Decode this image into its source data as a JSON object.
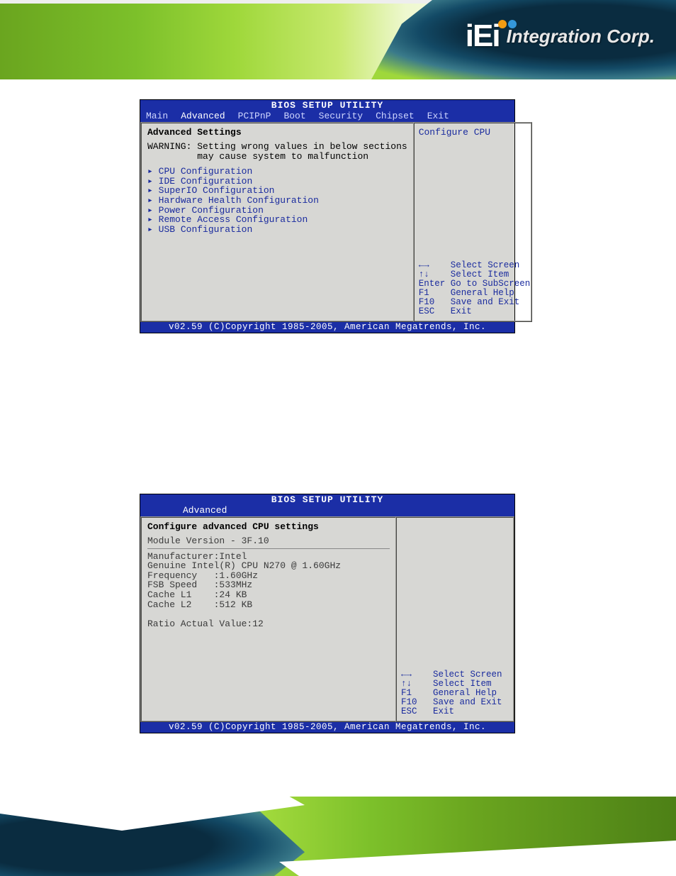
{
  "header": {
    "logo_prefix": "iEi",
    "logo_text": "Integration Corp."
  },
  "bios1": {
    "title": "BIOS SETUP UTILITY",
    "tabs": [
      "Main",
      "Advanced",
      "PCIPnP",
      "Boot",
      "Security",
      "Chipset",
      "Exit"
    ],
    "active_tab": "Advanced",
    "heading": "Advanced Settings",
    "warning_label": "WARNING:",
    "warning_text": "Setting wrong values in below sections\n         may cause system to malfunction",
    "menu_items": [
      "CPU Configuration",
      "IDE Configuration",
      "SuperIO Configuration",
      "Hardware Health Configuration",
      "Power Configuration",
      "Remote Access Configuration",
      "USB Configuration"
    ],
    "hint": "Configure CPU",
    "help": "←→    Select Screen\n↑↓    Select Item\nEnter Go to SubScreen\nF1    General Help\nF10   Save and Exit\nESC   Exit",
    "footer": "v02.59 (C)Copyright 1985-2005, American Megatrends, Inc."
  },
  "bios2": {
    "title": "BIOS SETUP UTILITY",
    "tab": "Advanced",
    "heading": "Configure advanced CPU settings",
    "module_line": "Module Version - 3F.10",
    "info_lines": "Manufacturer:Intel\nGenuine Intel(R) CPU N270 @ 1.60GHz\nFrequency   :1.60GHz\nFSB Speed   :533MHz\nCache L1    :24 KB\nCache L2    :512 KB\n\nRatio Actual Value:12",
    "help": "←→    Select Screen\n↑↓    Select Item\nF1    General Help\nF10   Save and Exit\nESC   Exit",
    "footer": "v02.59 (C)Copyright 1985-2005, American Megatrends, Inc."
  }
}
